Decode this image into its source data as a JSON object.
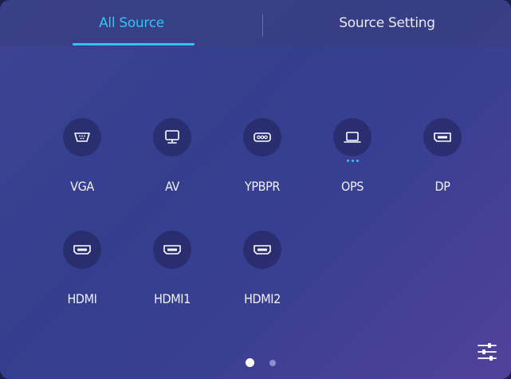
{
  "tabs": {
    "all_source": "All Source",
    "source_setting": "Source Setting"
  },
  "colors": {
    "accent": "#2fc4f4",
    "panel_start": "#3f4394",
    "panel_end": "#52419a"
  },
  "sources": [
    {
      "label": "VGA",
      "icon": "vga-port-icon"
    },
    {
      "label": "AV",
      "icon": "monitor-icon"
    },
    {
      "label": "YPBPR",
      "icon": "component-port-icon"
    },
    {
      "label": "OPS",
      "icon": "laptop-icon",
      "active": true
    },
    {
      "label": "DP",
      "icon": "displayport-icon"
    },
    {
      "label": "HDMI",
      "icon": "hdmi-port-icon"
    },
    {
      "label": "HDMI1",
      "icon": "hdmi-port-icon"
    },
    {
      "label": "HDMI2",
      "icon": "hdmi-port-icon"
    }
  ],
  "pagination": {
    "current_page": 1,
    "total_pages": 2
  },
  "settings_button_icon": "sliders-icon"
}
